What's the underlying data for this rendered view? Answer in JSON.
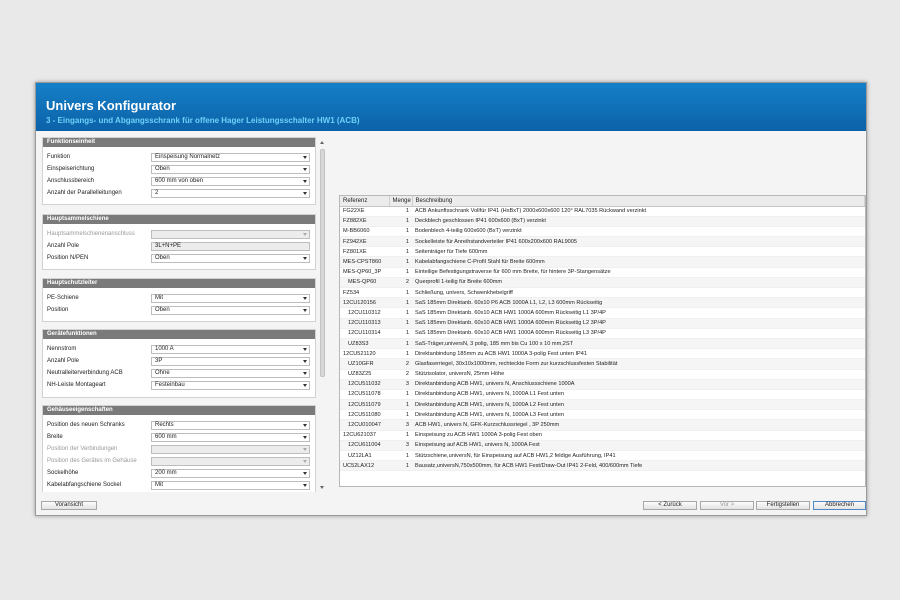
{
  "header": {
    "title": "Univers Konfigurator",
    "subtitle": "3 - Eingangs- und Abgangsschrank für offene Hager Leistungsschalter HW1 (ACB)"
  },
  "sections": {
    "funktionseinheit": {
      "title": "Funktionseinheit",
      "rows": [
        {
          "label": "Funktion",
          "value": "Einspeisung Normalnetz"
        },
        {
          "label": "Einspeiserichtung",
          "value": "Oben"
        },
        {
          "label": "Anschlussbereich",
          "value": "600 mm von oben"
        },
        {
          "label": "Anzahl der Parallelleitungen",
          "value": "2"
        }
      ]
    },
    "hauptsammelschiene": {
      "title": "Hauptsammelschiene",
      "rows": [
        {
          "label": "Hauptsammelschienenanschluss",
          "value": ""
        },
        {
          "label": "Anzahl Pole",
          "value": "3L+N+PE"
        },
        {
          "label": "Position N/PEN",
          "value": "Oben"
        }
      ]
    },
    "hauptschutzleiter": {
      "title": "Hauptschutzleiter",
      "rows": [
        {
          "label": "PE-Schiene",
          "value": "Mit"
        },
        {
          "label": "Position",
          "value": "Oben"
        }
      ]
    },
    "geraetefunktionen": {
      "title": "Gerätefunktionen",
      "rows": [
        {
          "label": "Nennstrom",
          "value": "1000 A"
        },
        {
          "label": "Anzahl Pole",
          "value": "3P"
        },
        {
          "label": "Neutralleiterverbindung ACB",
          "value": "Ohne"
        },
        {
          "label": "NH-Leiste Montageart",
          "value": "Festeinbau"
        }
      ]
    },
    "gehaeuse": {
      "title": "Gehäuseeigenschaften",
      "rows": [
        {
          "label": "Position des neuen Schranks",
          "value": "Rechts"
        },
        {
          "label": "Breite",
          "value": "600 mm"
        },
        {
          "label": "Position der Verbindungen",
          "value": ""
        },
        {
          "label": "Position des Gerätes im Gehäuse",
          "value": ""
        },
        {
          "label": "Sockelhöhe",
          "value": "200 mm"
        },
        {
          "label": "Kabelabfangschiene Sockel",
          "value": "Mit"
        }
      ]
    }
  },
  "table": {
    "headers": {
      "ref": "Referenz",
      "qty": "Menge",
      "desc": "Beschreibung"
    },
    "rows": [
      {
        "ref": "FG22XE",
        "qty": "1",
        "desc": "ACB Ankunftsschrank Vollfür IP41 (HxBxT) 2000x600x600 120° RAL7035 Rückwand verzinkt"
      },
      {
        "ref": "FZ882XE",
        "qty": "1",
        "desc": "Deckblech geschlossen IP41 600x600 (BxT) verzinkt"
      },
      {
        "ref": "M-BB6060",
        "qty": "1",
        "desc": "Bodenblech 4-teilig 600x600 (BxT) verzinkt"
      },
      {
        "ref": "FZ942XE",
        "qty": "1",
        "desc": "Sockelleiste für Anreihstandverteiler IP41 600x200x600 RAL9005"
      },
      {
        "ref": "FZ801XE",
        "qty": "1",
        "desc": "Seitenträger für Tiefe 600mm"
      },
      {
        "ref": "MES-CPST860",
        "qty": "1",
        "desc": "Kabelabfangschiene C-Profil Stahl für Breite 600mm"
      },
      {
        "ref": "MES-QP60_3P",
        "qty": "1",
        "desc": "Einteilige Befestigungstraverse für 600 mm Breite, für hintere 3P-Stangensätze"
      },
      {
        "ref": "MES-QP60",
        "qty": "2",
        "desc": "Querprofil 1-teilig für Breite 600mm"
      },
      {
        "ref": "FZ534",
        "qty": "1",
        "desc": "Schließung, univers, Schwenkhebelgriff"
      },
      {
        "ref": "12CU120156",
        "qty": "1",
        "desc": "SaS 185mm Direktanb. 60x10 P6 ACB 1000A L1, L2, L3 600mm Rückseitig"
      },
      {
        "ref": "12CU110312",
        "qty": "1",
        "desc": "SaS 185mm Direktanb. 60x10 ACB HW1 1000A 600mm Rückseitig L1 3P/4P"
      },
      {
        "ref": "12CU110313",
        "qty": "1",
        "desc": "SaS 185mm Direktanb. 60x10 ACB HW1 1000A 600mm Rückseitig L2 3P/4P"
      },
      {
        "ref": "12CU110314",
        "qty": "1",
        "desc": "SaS 185mm Direktanb. 60x10 ACB HW1 1000A 600mm Rückseitig L3 3P/4P"
      },
      {
        "ref": "UZ83S3",
        "qty": "1",
        "desc": "SaS-Träger,universN, 3 polig, 185 mm bis Cu 100 x 10 mm,2ST"
      },
      {
        "ref": "12CU521120",
        "qty": "1",
        "desc": "Direktanbindung 185mm zu ACB HW1 1000A 3-polig Fest unten IP41"
      },
      {
        "ref": "UZ10GFR",
        "qty": "2",
        "desc": "Glasfaserriegel, 30x10x1000mm, rechteckte Form zur kurzschlussfesten Stabilität"
      },
      {
        "ref": "UZ83Z25",
        "qty": "2",
        "desc": "Stützisolator, universN, 25mm Höhe"
      },
      {
        "ref": "12CU511032",
        "qty": "3",
        "desc": "Direktanbindung ACB HW1, univers N, Anschlussschiene 1000A"
      },
      {
        "ref": "12CU511078",
        "qty": "1",
        "desc": "Direktanbindung ACB HW1, univers N, 1000A L1 Fest unten"
      },
      {
        "ref": "12CU511079",
        "qty": "1",
        "desc": "Direktanbindung ACB HW1, univers N, 1000A L2 Fest unten"
      },
      {
        "ref": "12CU511080",
        "qty": "1",
        "desc": "Direktanbindung ACB HW1, univers N, 1000A L3 Fest unten"
      },
      {
        "ref": "12CU010047",
        "qty": "3",
        "desc": "ACB HW1, univers N, GFK-Kurzschlussriegel , 3P 250mm"
      },
      {
        "ref": "12CU621037",
        "qty": "1",
        "desc": "Einspeisung zu ACB HW1 1000A 3-polig Fest oben"
      },
      {
        "ref": "12CU611004",
        "qty": "3",
        "desc": "Einspeisung auf ACB HW1, univers N, 1000A Fest"
      },
      {
        "ref": "UZ12LA1",
        "qty": "1",
        "desc": "Stützschiene,universN, für Einspeisung auf ACB HW1,2 feldige Ausführung, IP41"
      },
      {
        "ref": "UC52LAX12",
        "qty": "1",
        "desc": "Bausatz,universN,750x500mm, für ACB HW1 Fest/Draw-Out IP41 2-Feld, 400/600mm Tiefe"
      }
    ]
  },
  "buttons": {
    "preview": "Voransicht",
    "back": "< Zurück",
    "next": "Vor >",
    "finish": "Fertigstellen",
    "cancel": "Abbrechen"
  }
}
